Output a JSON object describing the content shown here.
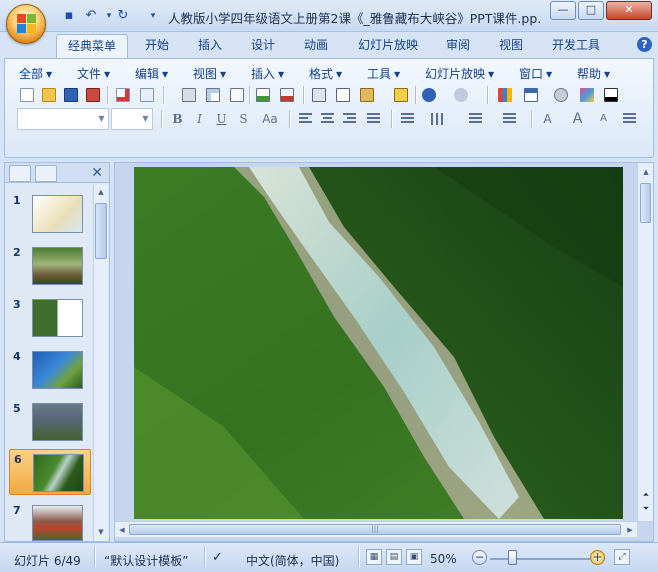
{
  "window": {
    "title": "人教版小学四年级语文上册第2课《_雅鲁藏布大峡谷》PPT课件.pp...",
    "controls": [
      "—",
      "□",
      "✕"
    ]
  },
  "quick_access": {
    "dropdown_glyph": "▾"
  },
  "tabs": [
    {
      "label": "经典菜单",
      "active": true
    },
    {
      "label": "开始"
    },
    {
      "label": "插入"
    },
    {
      "label": "设计"
    },
    {
      "label": "动画"
    },
    {
      "label": "幻灯片放映"
    },
    {
      "label": "审阅"
    },
    {
      "label": "视图"
    },
    {
      "label": "开发工具"
    }
  ],
  "help_label": "?",
  "menus": [
    "全部",
    "文件",
    "编辑",
    "视图",
    "插入",
    "格式",
    "工具",
    "幻灯片放映",
    "窗口",
    "帮助"
  ],
  "format_buttons": [
    "B",
    "I",
    "U",
    "S",
    "Aa"
  ],
  "panel": {
    "close_glyph": "✕"
  },
  "slides": [
    {
      "num": "1"
    },
    {
      "num": "2"
    },
    {
      "num": "3"
    },
    {
      "num": "4"
    },
    {
      "num": "5"
    },
    {
      "num": "6",
      "active": true
    },
    {
      "num": "7"
    }
  ],
  "status": {
    "slide_info": "幻灯片 6/49",
    "template": "“默认设计模板”",
    "language": "中文(简体，中国)",
    "zoom": "50%"
  },
  "colors": {
    "accent": "#15428b",
    "active_slide": "#f3a93e",
    "ribbon_bg": "#dce8f7"
  }
}
